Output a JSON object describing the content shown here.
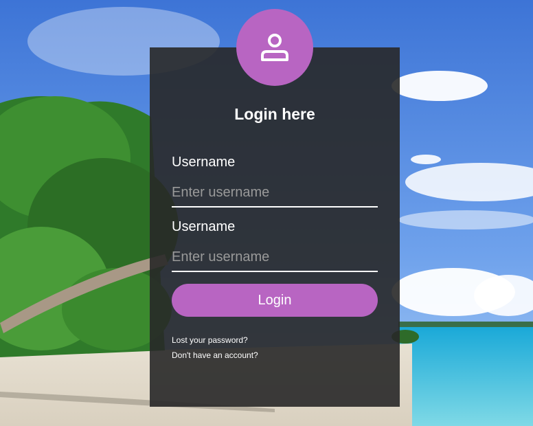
{
  "form": {
    "title": "Login here",
    "fields": [
      {
        "label": "Username",
        "placeholder": "Enter username",
        "value": ""
      },
      {
        "label": "Username",
        "placeholder": "Enter username",
        "value": ""
      }
    ],
    "login_button": "Login",
    "links": [
      "Lost your password?",
      "Don't have an account?"
    ]
  },
  "colors": {
    "accent": "#b865c2",
    "card_bg": "#3a3a3a"
  },
  "icons": {
    "avatar": "user-icon"
  }
}
